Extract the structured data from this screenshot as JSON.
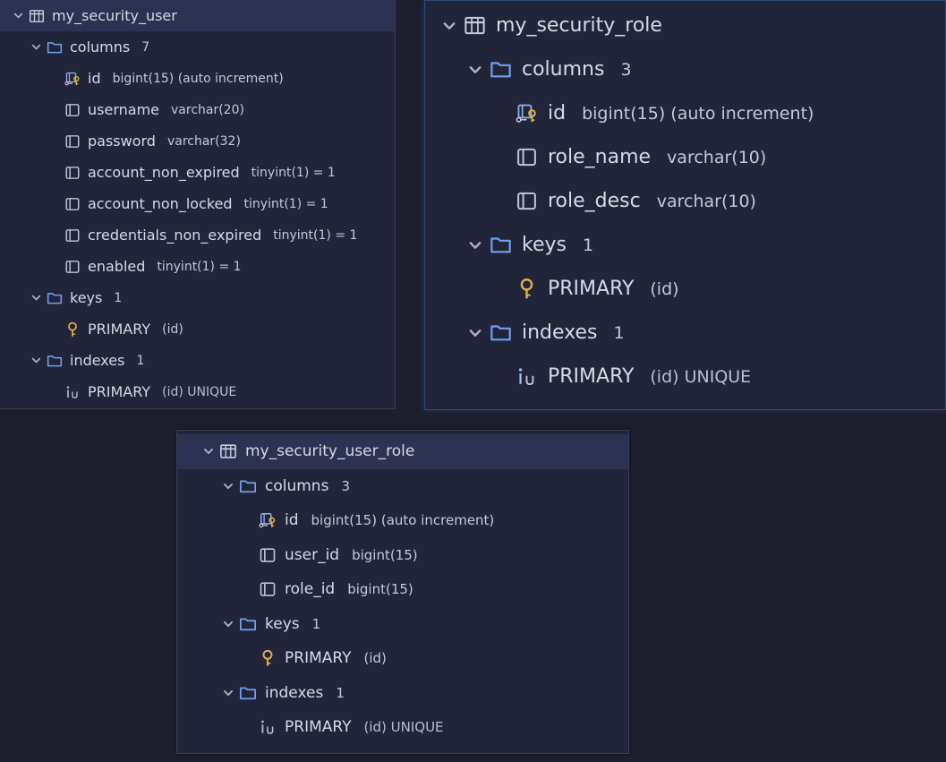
{
  "colors": {
    "background": "#1e1f2e",
    "panel": "#22253a",
    "selected_row": "#2d3252",
    "folder_icon": "#6fa1ee",
    "key_icon": "#e3b341",
    "text": "#d6d9e6"
  },
  "tables": [
    {
      "name": "my_security_user",
      "columns_label": "columns",
      "columns_count": "7",
      "columns": [
        {
          "name": "id",
          "type": "bigint(15) (auto increment)",
          "icon": "primary-key-column-icon"
        },
        {
          "name": "username",
          "type": "varchar(20)",
          "icon": "column-icon"
        },
        {
          "name": "password",
          "type": "varchar(32)",
          "icon": "column-icon"
        },
        {
          "name": "account_non_expired",
          "type": "tinyint(1) = 1",
          "icon": "column-icon"
        },
        {
          "name": "account_non_locked",
          "type": "tinyint(1) = 1",
          "icon": "column-icon"
        },
        {
          "name": "credentials_non_expired",
          "type": "tinyint(1) = 1",
          "icon": "column-icon"
        },
        {
          "name": "enabled",
          "type": "tinyint(1) = 1",
          "icon": "column-icon"
        }
      ],
      "keys_label": "keys",
      "keys_count": "1",
      "keys": [
        {
          "name": "PRIMARY",
          "detail": "(id)"
        }
      ],
      "indexes_label": "indexes",
      "indexes_count": "1",
      "indexes": [
        {
          "name": "PRIMARY",
          "detail": "(id) UNIQUE"
        }
      ]
    },
    {
      "name": "my_security_role",
      "columns_label": "columns",
      "columns_count": "3",
      "columns": [
        {
          "name": "id",
          "type": "bigint(15) (auto increment)",
          "icon": "primary-key-column-icon"
        },
        {
          "name": "role_name",
          "type": "varchar(10)",
          "icon": "column-icon"
        },
        {
          "name": "role_desc",
          "type": "varchar(10)",
          "icon": "column-icon"
        }
      ],
      "keys_label": "keys",
      "keys_count": "1",
      "keys": [
        {
          "name": "PRIMARY",
          "detail": "(id)"
        }
      ],
      "indexes_label": "indexes",
      "indexes_count": "1",
      "indexes": [
        {
          "name": "PRIMARY",
          "detail": "(id) UNIQUE"
        }
      ]
    },
    {
      "name": "my_security_user_role",
      "columns_label": "columns",
      "columns_count": "3",
      "columns": [
        {
          "name": "id",
          "type": "bigint(15) (auto increment)",
          "icon": "primary-key-column-icon"
        },
        {
          "name": "user_id",
          "type": "bigint(15)",
          "icon": "column-icon"
        },
        {
          "name": "role_id",
          "type": "bigint(15)",
          "icon": "column-icon"
        }
      ],
      "keys_label": "keys",
      "keys_count": "1",
      "keys": [
        {
          "name": "PRIMARY",
          "detail": "(id)"
        }
      ],
      "indexes_label": "indexes",
      "indexes_count": "1",
      "indexes": [
        {
          "name": "PRIMARY",
          "detail": "(id) UNIQUE"
        }
      ]
    }
  ]
}
